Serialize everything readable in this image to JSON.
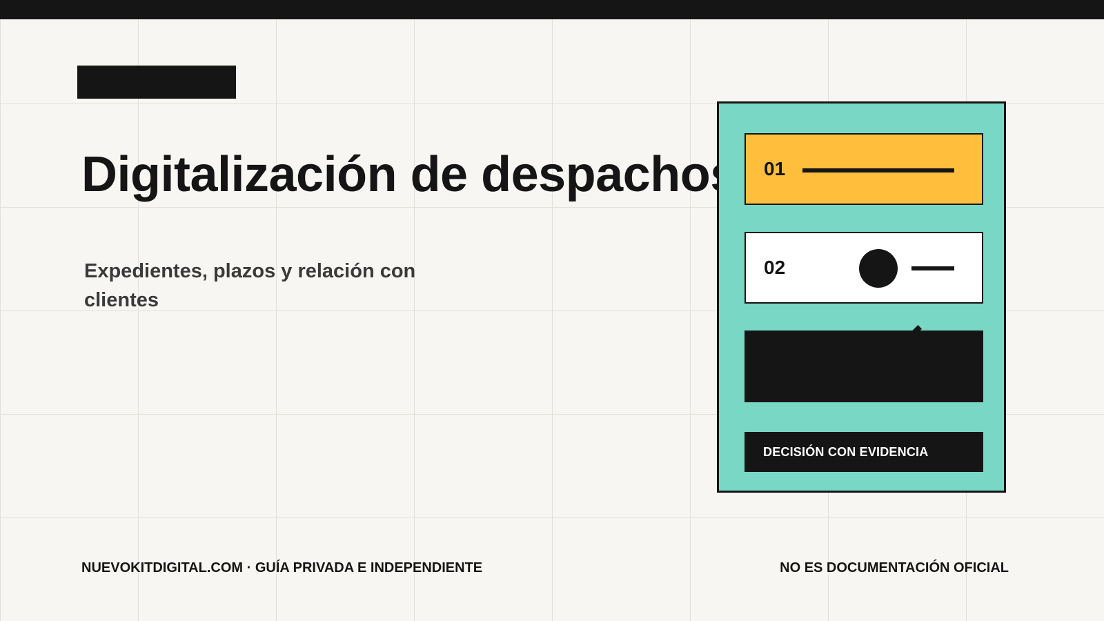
{
  "slide": {
    "title": "Digitalización de despachos",
    "subtitle": "Expedientes, plazos y relación con clientes"
  },
  "card": {
    "rows": [
      {
        "number": "01"
      },
      {
        "number": "02"
      }
    ],
    "decision_label": "DECISIÓN CON EVIDENCIA"
  },
  "footer": {
    "left": "NUEVOKITDIGITAL.COM · GUÍA PRIVADA E INDEPENDIENTE",
    "right": "NO ES DOCUMENTACIÓN OFICIAL"
  },
  "colors": {
    "background": "#f7f6f2",
    "ink": "#151515",
    "card": "#79d7c5",
    "highlight": "#ffbf3c"
  }
}
